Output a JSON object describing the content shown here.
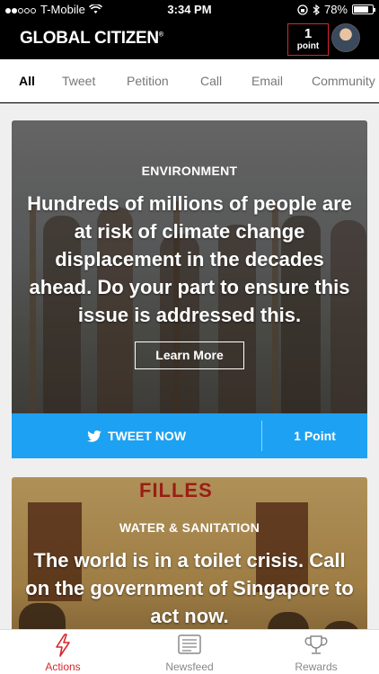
{
  "status_bar": {
    "carrier": "T-Mobile",
    "time": "3:34 PM",
    "battery": "78%",
    "battery_level": 0.78
  },
  "header": {
    "logo": "GLOBAL CITIZEN",
    "points_value": "1",
    "points_label": "point"
  },
  "tabs": [
    {
      "label": "All",
      "active": true
    },
    {
      "label": "Tweet"
    },
    {
      "label": "Petition"
    },
    {
      "label": "Call"
    },
    {
      "label": "Email"
    },
    {
      "label": "Community"
    }
  ],
  "cards": [
    {
      "category": "ENVIRONMENT",
      "headline": "Hundreds of millions of people are at risk of climate change displacement in the decades ahead. Do your part to ensure this issue is addressed this.",
      "cta": "Learn More",
      "action_label": "TWEET NOW",
      "action_points": "1 Point"
    },
    {
      "category": "WATER & SANITATION",
      "headline": "The world is in a toilet crisis. Call on the government of Singapore to act now.",
      "image_text": "FILLES"
    }
  ],
  "bottom_nav": [
    {
      "label": "Actions",
      "icon": "lightning-icon",
      "active": true
    },
    {
      "label": "Newsfeed",
      "icon": "newspaper-icon"
    },
    {
      "label": "Rewards",
      "icon": "trophy-icon"
    }
  ],
  "colors": {
    "brand_red": "#d8262c",
    "twitter_blue": "#1da1f2",
    "header_bg": "#000000"
  }
}
